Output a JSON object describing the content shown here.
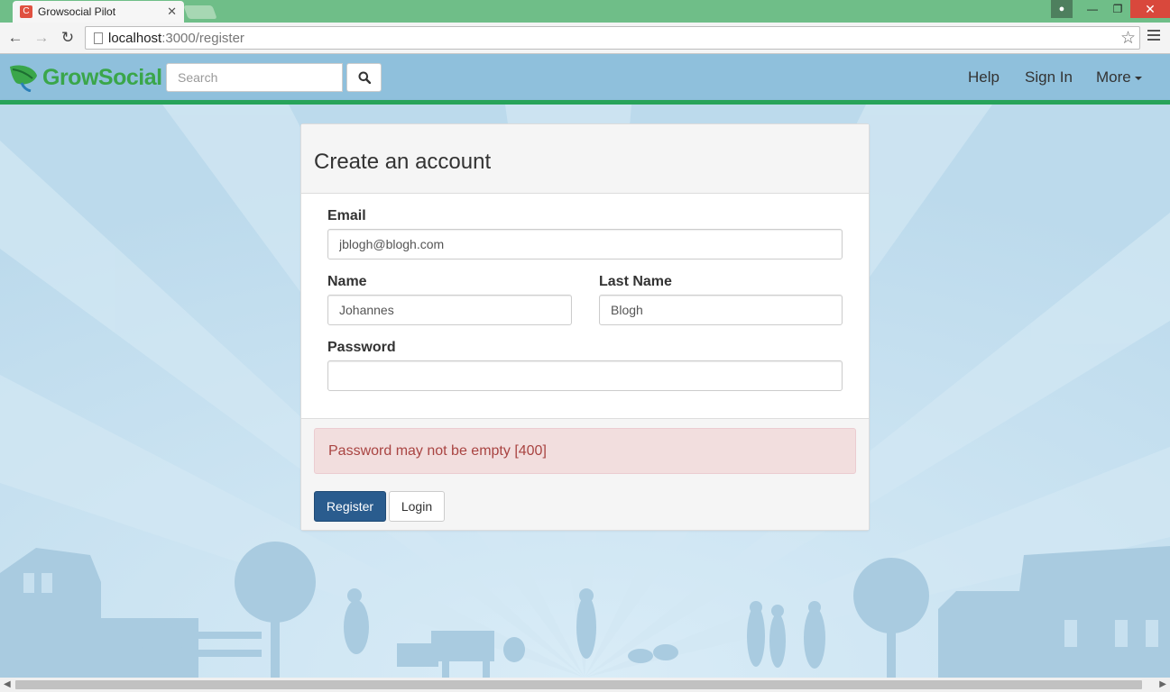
{
  "browser": {
    "tab_title": "Growsocial Pilot",
    "tab_favicon": "C",
    "tab_close": "✕",
    "url_host": "localhost",
    "url_path": ":3000/register"
  },
  "header": {
    "logo_grow": "Grow",
    "logo_social": "Social",
    "search_placeholder": "Search",
    "nav": {
      "help": "Help",
      "sign_in": "Sign In",
      "more": "More"
    }
  },
  "form": {
    "title": "Create an account",
    "email_label": "Email",
    "email_value": "jblogh@blogh.com",
    "name_label": "Name",
    "name_value": "Johannes",
    "last_name_label": "Last Name",
    "last_name_value": "Blogh",
    "password_label": "Password",
    "password_value": "",
    "error_message": "Password may not be empty [400]",
    "register_label": "Register",
    "login_label": "Login"
  },
  "colors": {
    "brand_green": "#27a35a",
    "primary_button": "#2a5c8e",
    "alert_text": "#a94442",
    "header_bg": "#8fc0dc"
  }
}
